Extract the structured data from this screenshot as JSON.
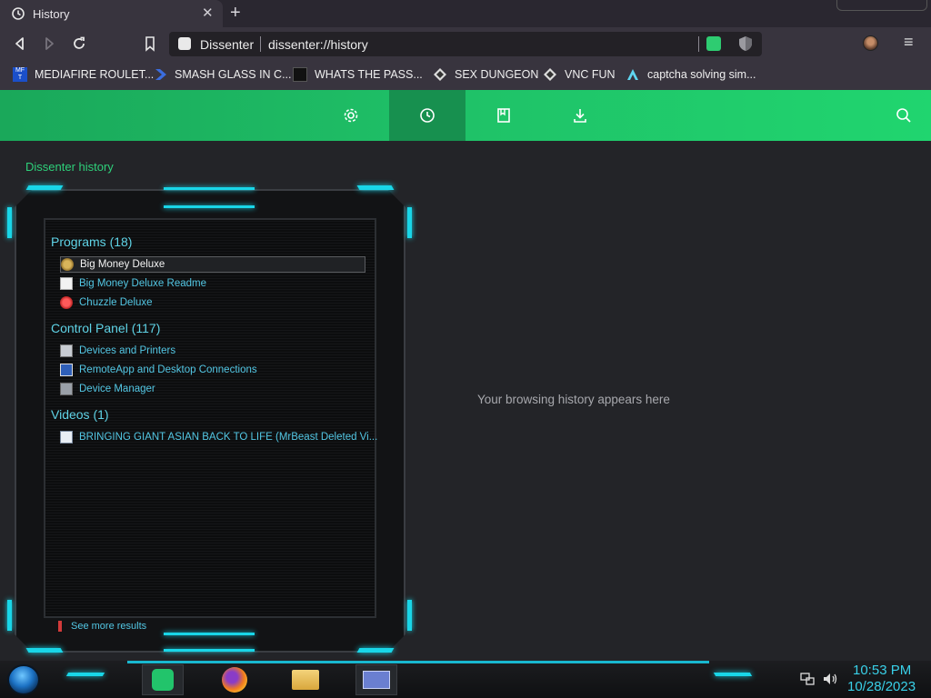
{
  "tab": {
    "title": "History",
    "close": "✕",
    "new_tab": "+"
  },
  "toolbar": {
    "site": "Dissenter",
    "url": "dissenter://history"
  },
  "bookmarks": [
    {
      "label": "MEDIAFIRE ROULET...",
      "icon": "mediafire-icon"
    },
    {
      "label": "SMASH GLASS IN C...",
      "icon": "chevron-logo-icon"
    },
    {
      "label": "WHATS THE PASS...",
      "icon": "dark-square-icon"
    },
    {
      "label": "SEX DUNGEON",
      "icon": "diamond-logo-icon"
    },
    {
      "label": "VNC FUN",
      "icon": "diamond-logo-icon"
    },
    {
      "label": "captcha solving sim...",
      "icon": "arrow-logo-icon"
    }
  ],
  "dissenter": {
    "page_title": "Dissenter history",
    "empty_message": "Your browsing history appears here",
    "nav": [
      "settings-icon",
      "history-icon",
      "bookmarks-icon",
      "downloads-icon"
    ],
    "accent": "#20d56f"
  },
  "start_menu": {
    "programs_header": "Programs (18)",
    "programs": [
      "Big Money Deluxe",
      "Big Money Deluxe Readme",
      "Chuzzle Deluxe"
    ],
    "control_header": "Control Panel (117)",
    "control": [
      "Devices and Printers",
      "RemoteApp and Desktop Connections",
      "Device Manager"
    ],
    "videos_header": "Videos (1)",
    "videos": [
      "BRINGING GIANT ASIAN BACK TO LIFE (MrBeast Deleted Vi..."
    ],
    "see_more": "See more results",
    "accent": "#19d6e8"
  },
  "taskbar": {
    "time": "10:53 PM",
    "date": "10/28/2023"
  }
}
